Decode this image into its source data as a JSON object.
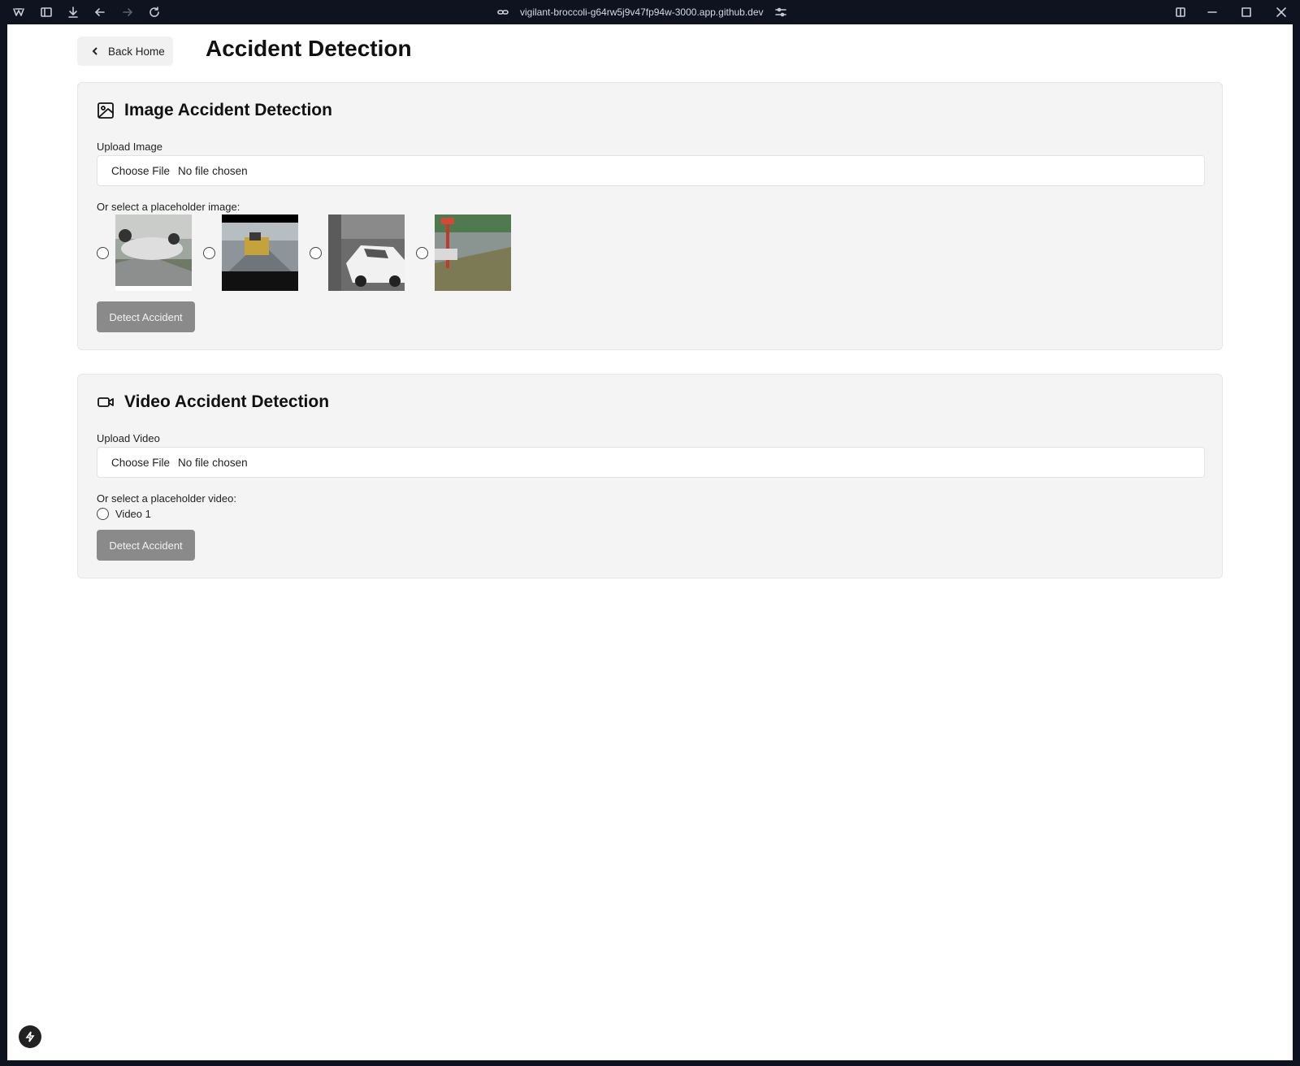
{
  "browser": {
    "url": "vigilant-broccoli-g64rw5j9v47fp94w-3000.app.github.dev"
  },
  "header": {
    "back_label": "Back Home",
    "title": "Accident Detection"
  },
  "image_section": {
    "title": "Image Accident Detection",
    "upload_label": "Upload Image",
    "choose_file": "Choose File",
    "file_status": "No file chosen",
    "placeholder_label": "Or select a placeholder image:",
    "placeholder_images": [
      {
        "name": "overturned-car",
        "selected": false
      },
      {
        "name": "construction-truck-road",
        "selected": false
      },
      {
        "name": "white-car-crash",
        "selected": false
      },
      {
        "name": "flooded-street",
        "selected": false
      }
    ],
    "detect_label": "Detect Accident"
  },
  "video_section": {
    "title": "Video Accident Detection",
    "upload_label": "Upload Video",
    "choose_file": "Choose File",
    "file_status": "No file chosen",
    "placeholder_label": "Or select a placeholder video:",
    "placeholder_videos": [
      {
        "label": "Video 1",
        "selected": false
      }
    ],
    "detect_label": "Detect Accident"
  },
  "colors": {
    "chrome_bg": "#0f1320",
    "card_bg": "#f4f4f4",
    "detect_button": "#8a8a8a"
  }
}
